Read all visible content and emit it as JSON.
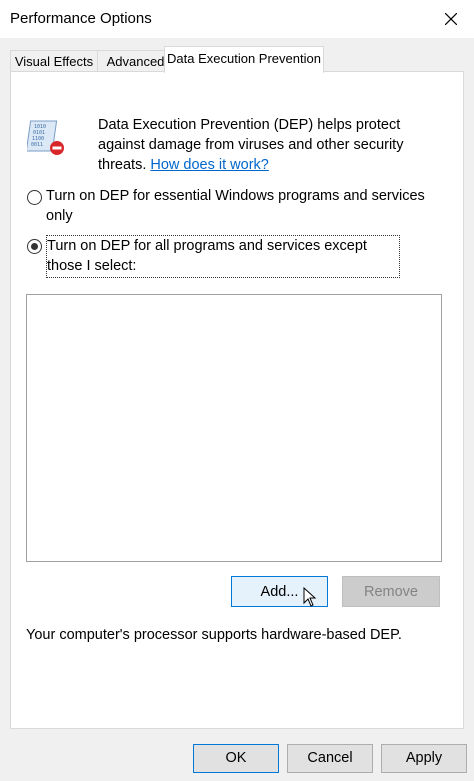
{
  "window": {
    "title": "Performance Options",
    "close_icon": "close-icon"
  },
  "tabs": [
    {
      "label": "Visual Effects",
      "active": false
    },
    {
      "label": "Advanced",
      "active": false
    },
    {
      "label": "Data Execution Prevention",
      "active": true
    }
  ],
  "dep": {
    "description": "Data Execution Prevention (DEP) helps protect against damage from viruses and other security threats.",
    "link": "How does it work?",
    "options": [
      {
        "label": "Turn on DEP for essential Windows programs and services only",
        "selected": false
      },
      {
        "label": "Turn on DEP for all programs and services except those I select:",
        "selected": true
      }
    ],
    "add_label": "Add...",
    "remove_label": "Remove",
    "support_text": "Your computer's processor supports hardware-based DEP."
  },
  "footer": {
    "ok_label": "OK",
    "cancel_label": "Cancel",
    "apply_label": "Apply"
  },
  "colors": {
    "link": "#0066cc",
    "focus_border": "#0078d7"
  }
}
